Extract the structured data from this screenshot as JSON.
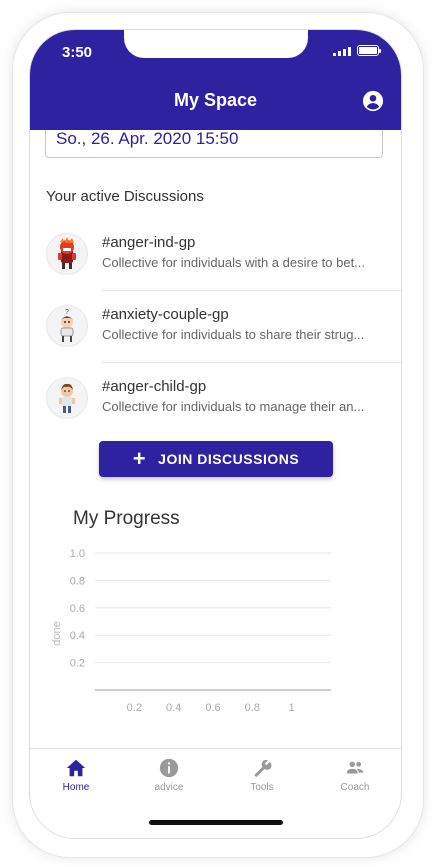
{
  "status_bar": {
    "time": "3:50"
  },
  "header": {
    "title": "My Space"
  },
  "date_field": {
    "value": "So., 26. Apr. 2020 15:50"
  },
  "discussions": {
    "section_title": "Your active Discussions",
    "items": [
      {
        "name": "#anger-ind-gp",
        "description": "Collective for individuals with a desire to bet...",
        "avatar": "angry-character-avatar"
      },
      {
        "name": "#anxiety-couple-gp",
        "description": "Collective for individuals to share their strug...",
        "avatar": "anxious-character-avatar"
      },
      {
        "name": "#anger-child-gp",
        "description": "Collective for individuals to manage their an...",
        "avatar": "child-character-avatar"
      }
    ],
    "join_button_label": "JOIN DISCUSSIONS"
  },
  "progress": {
    "title": "My Progress"
  },
  "chart_data": {
    "type": "line",
    "title": "My Progress",
    "xlabel": "",
    "ylabel": "done",
    "x_ticks": [
      "0.2",
      "0.4",
      "0.6",
      "0.8",
      "1"
    ],
    "y_ticks": [
      "1.0",
      "0.8",
      "0.6",
      "0.4",
      "0.2"
    ],
    "xlim": [
      0,
      1.2
    ],
    "ylim": [
      0,
      1.0
    ],
    "grid": true,
    "series": []
  },
  "bottom_nav": {
    "items": [
      {
        "label": "Home",
        "icon": "home-icon",
        "active": true
      },
      {
        "label": "advice",
        "icon": "info-icon",
        "active": false
      },
      {
        "label": "Tools",
        "icon": "wrench-icon",
        "active": false
      },
      {
        "label": "Coach",
        "icon": "people-icon",
        "active": false
      }
    ]
  },
  "colors": {
    "primary": "#2e22a0",
    "inactive": "#9a9a9a"
  }
}
